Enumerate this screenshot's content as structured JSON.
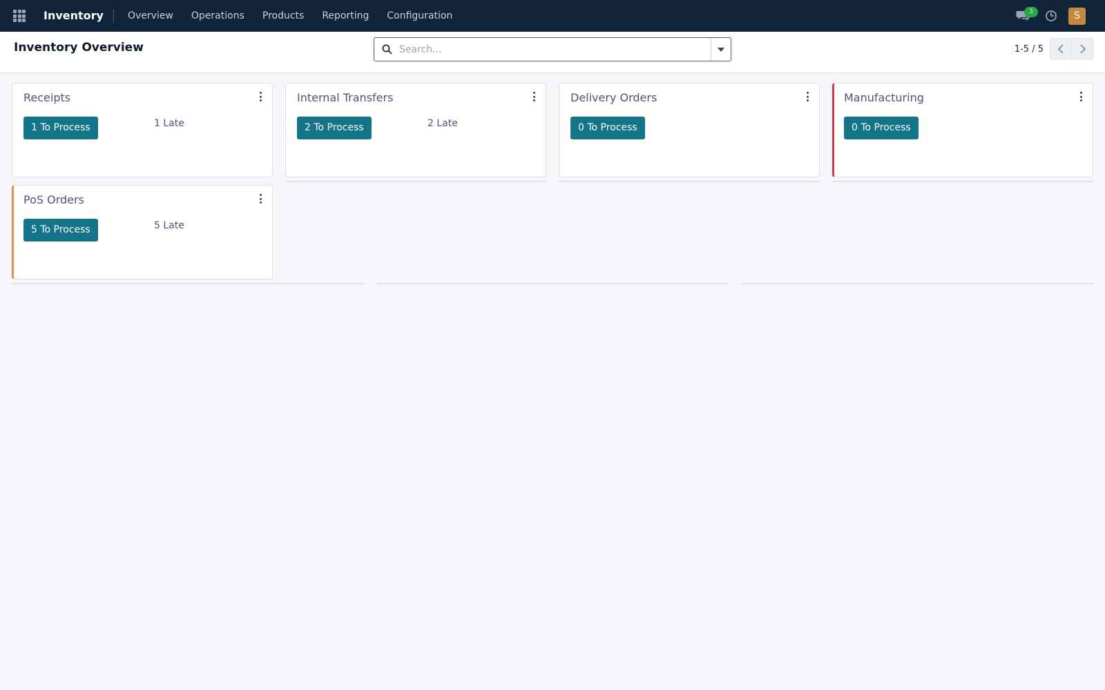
{
  "navbar": {
    "brand": "Inventory",
    "menu": [
      "Overview",
      "Operations",
      "Products",
      "Reporting",
      "Configuration"
    ],
    "chat_badge": "3",
    "avatar_initial": "S",
    "icons": [
      "apps-grid-icon",
      "chat-icon",
      "clock-icon"
    ]
  },
  "control_panel": {
    "title": "Inventory Overview",
    "search_placeholder": "Search...",
    "pager": "1-5 / 5"
  },
  "cards": [
    {
      "title": "Receipts",
      "process_label": "1 To Process",
      "late_label": "1 Late",
      "accent": ""
    },
    {
      "title": "Internal Transfers",
      "process_label": "2 To Process",
      "late_label": "2 Late",
      "accent": ""
    },
    {
      "title": "Delivery Orders",
      "process_label": "0 To Process",
      "late_label": "",
      "accent": ""
    },
    {
      "title": "Manufacturing",
      "process_label": "0 To Process",
      "late_label": "",
      "accent": "#dc3545"
    },
    {
      "title": "PoS Orders",
      "process_label": "5 To Process",
      "late_label": "5 Late",
      "accent": "#e9913a"
    }
  ],
  "colors": {
    "navbar_bg": "#12243a",
    "primary_button": "#13758a",
    "title_purple": "#5a4b87",
    "badge_green": "#28a745",
    "avatar_bg": "#c38a3d"
  }
}
